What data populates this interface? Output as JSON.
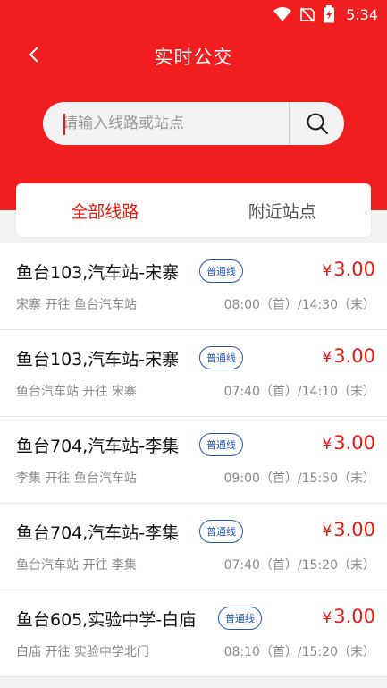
{
  "status": {
    "time": "5:34"
  },
  "header": {
    "title": "实时公交"
  },
  "search": {
    "placeholder": "请输入线路或站点"
  },
  "tabs": [
    {
      "label": "全部线路",
      "active": true
    },
    {
      "label": "附近站点",
      "active": false
    }
  ],
  "routes": [
    {
      "name": "鱼台103,汽车站-宋寨",
      "badge": "普通线",
      "currency": "¥",
      "price": "3.00",
      "direction": "宋寨 开往 鱼台汽车站",
      "times": "08:00（首）/14:30（末）"
    },
    {
      "name": "鱼台103,汽车站-宋寨",
      "badge": "普通线",
      "currency": "¥",
      "price": "3.00",
      "direction": "鱼台汽车站 开往 宋寨",
      "times": "07:40（首）/14:10（末）"
    },
    {
      "name": "鱼台704,汽车站-李集",
      "badge": "普通线",
      "currency": "¥",
      "price": "3.00",
      "direction": "李集 开往 鱼台汽车站",
      "times": "09:00（首）/15:50（末）"
    },
    {
      "name": "鱼台704,汽车站-李集",
      "badge": "普通线",
      "currency": "¥",
      "price": "3.00",
      "direction": "鱼台汽车站 开往 李集",
      "times": "07:40（首）/15:20（末）"
    },
    {
      "name": "鱼台605,实验中学-白庙",
      "badge": "普通线",
      "currency": "¥",
      "price": "3.00",
      "direction": "白庙 开往 实验中学北门",
      "times": "08:10（首）/15:20（末）"
    }
  ],
  "icons": {
    "wifi": "wifi-icon",
    "signal": "no-signal-icon",
    "battery": "battery-charging-icon",
    "back": "chevron-left-icon",
    "search": "search-icon"
  },
  "colors": {
    "brand_red": "#f01e1e",
    "price_red": "#e8190f",
    "badge_blue": "#2355b8"
  }
}
